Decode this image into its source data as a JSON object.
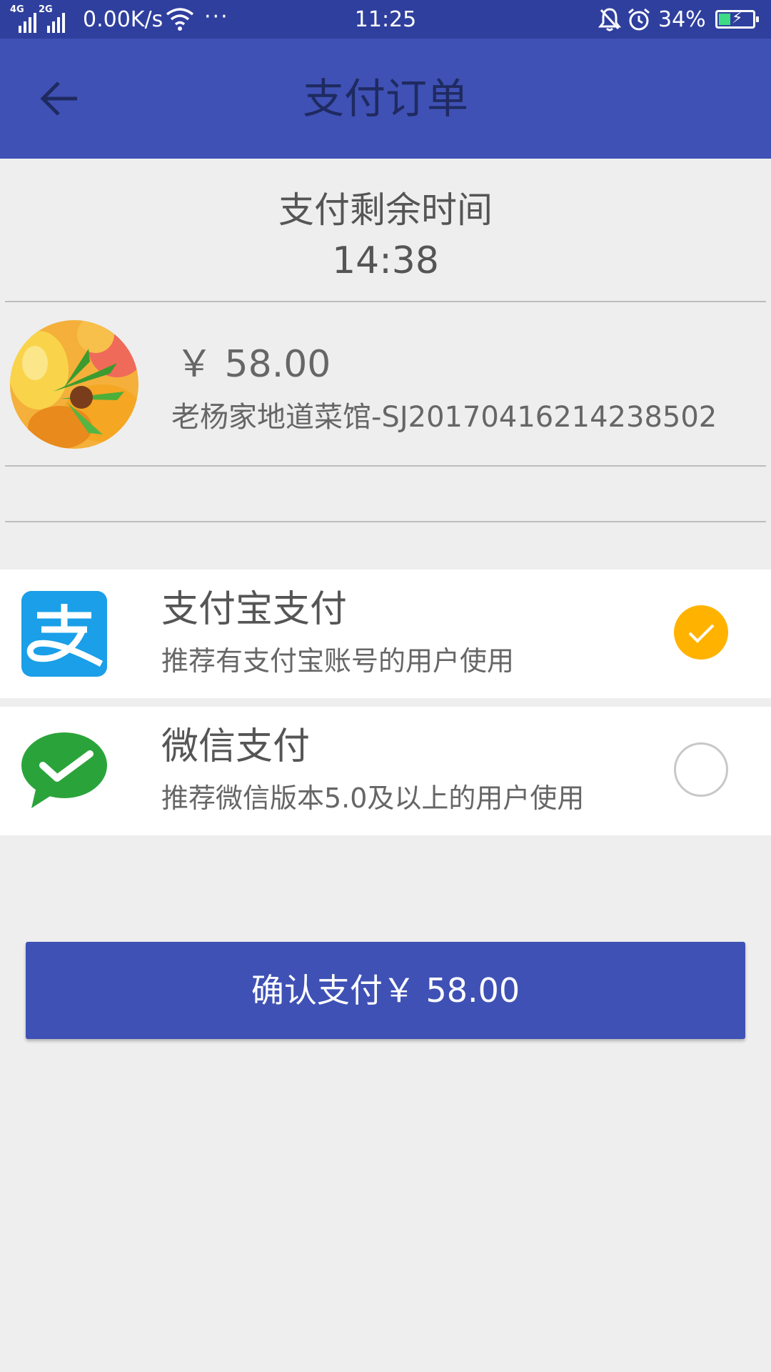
{
  "status_bar": {
    "signal1_label": "4G",
    "signal2_label": "2G",
    "speed": "0.00K/s",
    "dots": "···",
    "time": "11:25",
    "battery_percent": "34%",
    "battery_level": 0.34,
    "icons": [
      "signal-icon",
      "wifi-icon",
      "bell-off-icon",
      "alarm-icon",
      "battery-charging-icon"
    ]
  },
  "header": {
    "title": "支付订单",
    "back_icon": "arrow-left-icon"
  },
  "timer": {
    "label": "支付剩余时间",
    "value": "14:38"
  },
  "order": {
    "image": "fruit-avatar",
    "price": "￥ 58.00",
    "merchant_order": "老杨家地道菜馆-SJ20170416214238502"
  },
  "payment_methods": [
    {
      "name": "支付宝支付",
      "desc": "推荐有支付宝账号的用户使用",
      "icon": "alipay-icon",
      "selected": true
    },
    {
      "name": "微信支付",
      "desc": "推荐微信版本5.0及以上的用户使用",
      "icon": "wechat-icon",
      "selected": false
    }
  ],
  "confirm_button": {
    "label": "确认支付￥ 58.00"
  },
  "colors": {
    "primary": "#3f51b5",
    "status_bar": "#2f3f9e",
    "background": "#eeeeee",
    "selected": "#ffb300",
    "alipay": "#1a9fe8",
    "wechat": "#2aa43a"
  }
}
